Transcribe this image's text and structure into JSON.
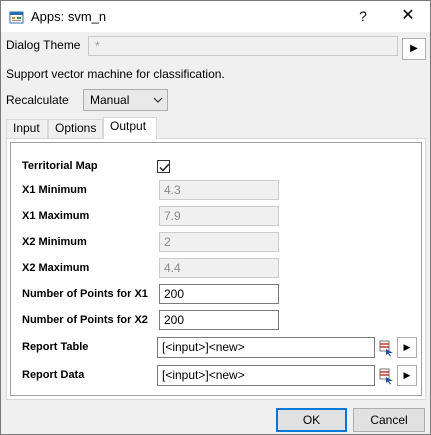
{
  "window": {
    "title": "Apps: svm_n",
    "help_label": "?",
    "close_label": "✕"
  },
  "theme": {
    "label": "Dialog Theme",
    "value": "*"
  },
  "description": "Support vector machine for classification.",
  "recalculate": {
    "label": "Recalculate",
    "value": "Manual"
  },
  "tabs": [
    {
      "label": "Input"
    },
    {
      "label": "Options"
    },
    {
      "label": "Output"
    }
  ],
  "output": {
    "territorial_map": {
      "label": "Territorial Map",
      "checked": true
    },
    "x1_min": {
      "label": "X1 Minimum",
      "value": "4.3"
    },
    "x1_max": {
      "label": "X1 Maximum",
      "value": "7.9"
    },
    "x2_min": {
      "label": "X2 Minimum",
      "value": "2"
    },
    "x2_max": {
      "label": "X2 Maximum",
      "value": "4.4"
    },
    "points_x1": {
      "label": "Number of Points for X1",
      "value": "200"
    },
    "points_x2": {
      "label": "Number of Points for X2",
      "value": "200"
    },
    "report_table": {
      "label": "Report Table",
      "value": "[<input>]<new>"
    },
    "report_data": {
      "label": "Report Data",
      "value": "[<input>]<new>"
    }
  },
  "buttons": {
    "ok": "OK",
    "cancel": "Cancel"
  },
  "colors": {
    "accent": "#0078d7",
    "window_bg": "#f0f0f0"
  }
}
